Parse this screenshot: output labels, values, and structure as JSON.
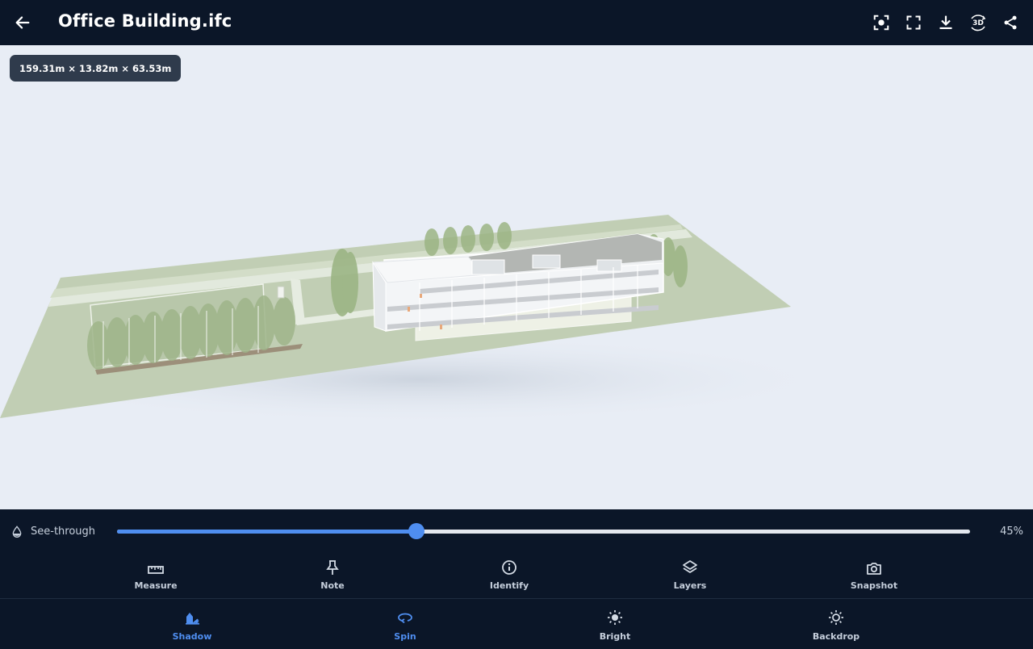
{
  "header": {
    "title": "Office Building.ifc",
    "back_icon": "arrow-left-icon",
    "actions": [
      {
        "icon": "focus-icon"
      },
      {
        "icon": "fullscreen-icon"
      },
      {
        "icon": "download-icon"
      },
      {
        "icon": "3d-rotate-icon",
        "text": "3D"
      },
      {
        "icon": "share-icon"
      }
    ]
  },
  "viewport": {
    "dimensions": "159.31m × 13.82m × 63.53m",
    "background": "#e8edf5"
  },
  "seethrough": {
    "label": "See-through",
    "value": 45,
    "value_text": "45%",
    "icon": "droplet-icon"
  },
  "tools": [
    {
      "label": "Measure",
      "icon": "ruler-icon"
    },
    {
      "label": "Note",
      "icon": "pin-icon"
    },
    {
      "label": "Identify",
      "icon": "info-icon"
    },
    {
      "label": "Layers",
      "icon": "layers-icon"
    },
    {
      "label": "Snapshot",
      "icon": "camera-icon"
    }
  ],
  "bottom_nav": [
    {
      "label": "Shadow",
      "icon": "shadow-icon",
      "active": true
    },
    {
      "label": "Spin",
      "icon": "spin-icon",
      "active": true
    },
    {
      "label": "Bright",
      "icon": "sun-icon",
      "active": false
    },
    {
      "label": "Backdrop",
      "icon": "backdrop-sun-icon",
      "active": false
    }
  ],
  "colors": {
    "bar": "#0b1628",
    "accent": "#4f8ef0",
    "viewport": "#e8edf5",
    "ground": "#bfcdb2"
  }
}
